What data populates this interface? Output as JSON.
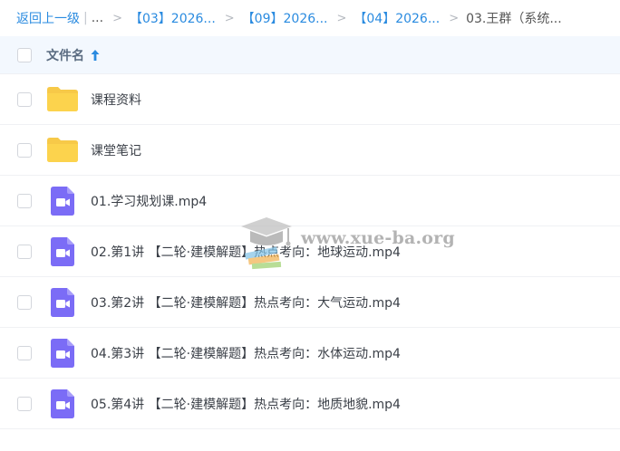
{
  "breadcrumb": {
    "back_label": "返回上一级",
    "pipe": "|",
    "ellipsis": "...",
    "separator": ">",
    "crumbs": [
      "【03】2026...",
      "【09】2026...",
      "【04】2026..."
    ],
    "current": "03.王群（系统..."
  },
  "list_header": {
    "column_label": "文件名",
    "sort_icon": "arrow-up-icon"
  },
  "files": [
    {
      "name": "课程资料",
      "icon": "folder-icon"
    },
    {
      "name": "课堂笔记",
      "icon": "folder-icon"
    },
    {
      "name": "01.学习规划课.mp4",
      "icon": "video-file-icon"
    },
    {
      "name": "02.第1讲 【二轮·建模解题】热点考向：地球运动.mp4",
      "icon": "video-file-icon"
    },
    {
      "name": "03.第2讲 【二轮·建模解题】热点考向：大气运动.mp4",
      "icon": "video-file-icon"
    },
    {
      "name": "04.第3讲 【二轮·建模解题】热点考向：水体运动.mp4",
      "icon": "video-file-icon"
    },
    {
      "name": "05.第4讲 【二轮·建模解题】热点考向：地质地貌.mp4",
      "icon": "video-file-icon"
    }
  ],
  "watermark": {
    "text": "www.xue-ba.org",
    "icon": "graduation-cap-icon"
  },
  "colors": {
    "link": "#2a8be0",
    "header_bg": "#f3f8fe",
    "folder": "#fcd34d",
    "video": "#7b6cf6"
  }
}
